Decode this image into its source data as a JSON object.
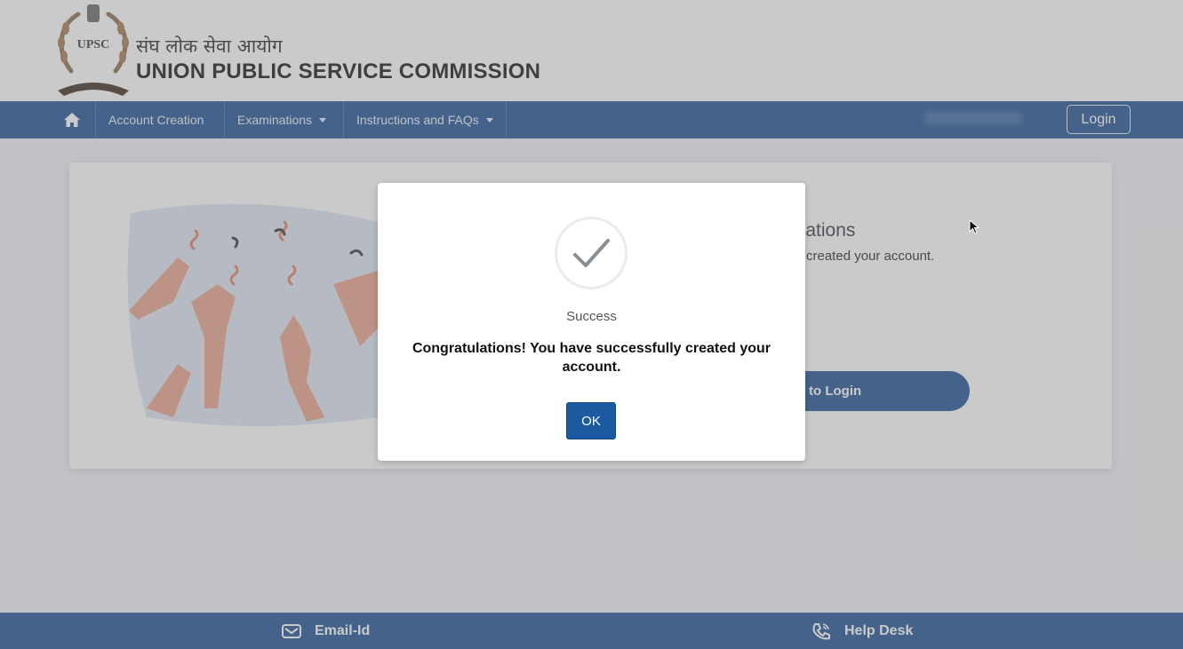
{
  "header": {
    "logo_text": "UPSC",
    "title_hindi": "संघ लोक सेवा आयोग",
    "title_english": "UNION PUBLIC SERVICE COMMISSION"
  },
  "nav": {
    "home_icon": "home-icon",
    "items": [
      {
        "label": "Account Creation",
        "dropdown": false
      },
      {
        "label": "Examinations",
        "dropdown": true
      },
      {
        "label": "Instructions and FAQs",
        "dropdown": true
      }
    ],
    "login_label": "Login"
  },
  "background_card": {
    "heading_partial": "ulations",
    "text_partial": "created your account.",
    "button_partial": "to Login"
  },
  "modal": {
    "icon": "checkmark-icon",
    "title": "Success",
    "message": "Congratulations! You have successfully created your account.",
    "ok_label": "OK"
  },
  "footer": {
    "email_label": "Email-Id",
    "email_icon": "mail-icon",
    "helpdesk_label": "Help Desk",
    "helpdesk_icon": "phone-icon"
  },
  "colors": {
    "primary": "#1b4f91",
    "ok_button": "#1b5aa0",
    "overlay": "rgba(128,128,128,0.42)"
  }
}
